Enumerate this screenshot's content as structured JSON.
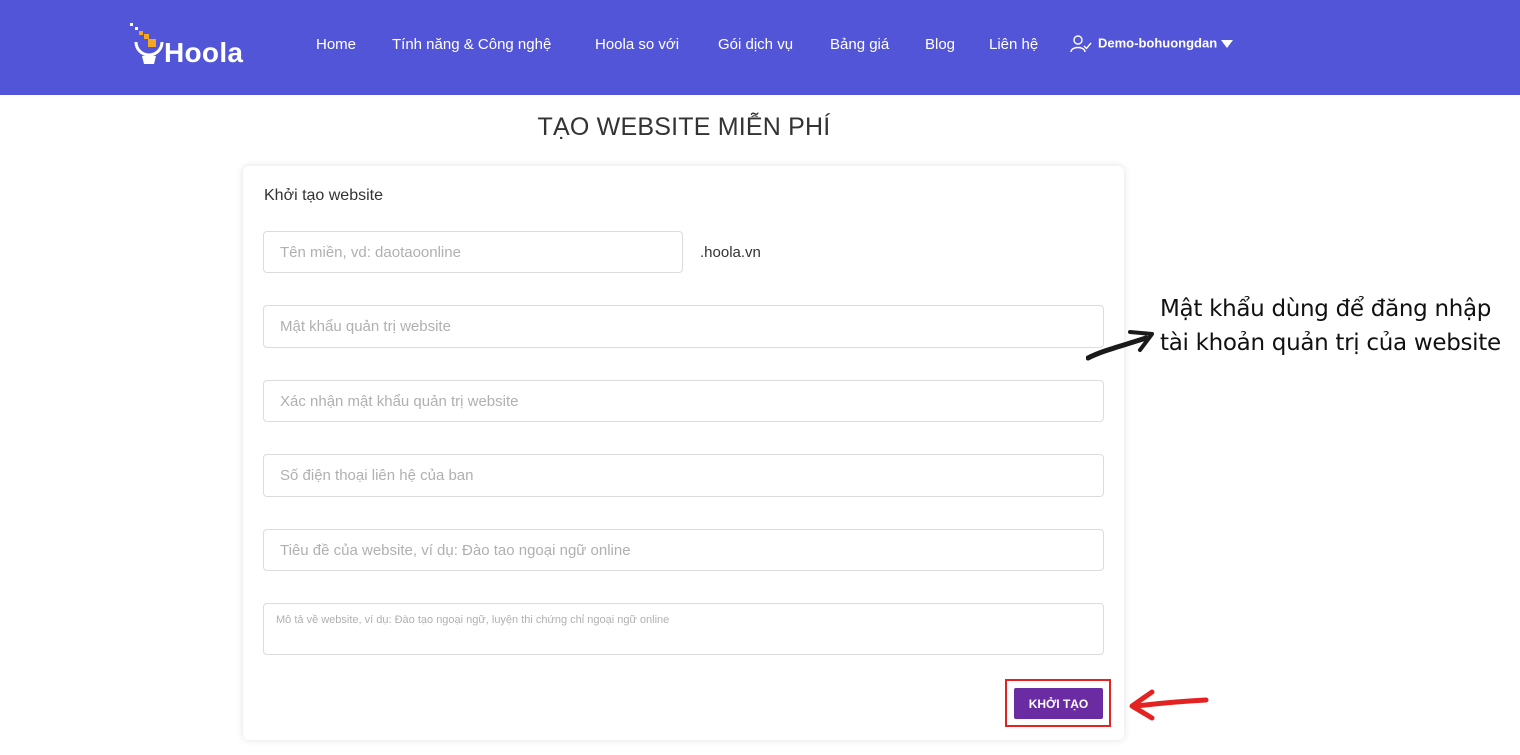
{
  "header": {
    "logo_text": "Hoola",
    "nav": [
      {
        "label": "Home"
      },
      {
        "label": "Tính năng & Công nghệ"
      },
      {
        "label": "Hoola so với"
      },
      {
        "label": "Gói dịch vụ"
      },
      {
        "label": "Bảng giá"
      },
      {
        "label": "Blog"
      },
      {
        "label": "Liên hệ"
      }
    ],
    "user": {
      "name": "Demo-bohuongdan",
      "icon": "user-check-icon"
    }
  },
  "page_title": "TẠO WEBSITE MIỄN PHÍ",
  "form": {
    "title": "Khởi tạo website",
    "domain": {
      "placeholder": "Tên miền, vd: daotaoonline",
      "value": "",
      "suffix": ".hoola.vn"
    },
    "password": {
      "placeholder": "Mật khẩu quản trị website",
      "value": ""
    },
    "confirm_password": {
      "placeholder": "Xác nhận mật khẩu quản trị website",
      "value": ""
    },
    "phone": {
      "placeholder": "Số điện thoại liên hệ của ban",
      "value": ""
    },
    "site_title": {
      "placeholder": "Tiêu đề của website, ví dụ: Đào tao ngoại ngữ online",
      "value": ""
    },
    "description": {
      "placeholder": "Mô tả về website, ví dụ: Đào tạo ngoại ngữ, luyện thi chứng chỉ ngoại ngữ online",
      "value": ""
    },
    "submit_label": "KHỞI TẠO"
  },
  "annotation": {
    "line1": "Mật khẩu dùng để đăng nhập",
    "line2": "tài khoản quản trị của website"
  },
  "colors": {
    "navbar": "#5355d8",
    "button": "#6a2ba3",
    "highlight": "#e32221"
  }
}
